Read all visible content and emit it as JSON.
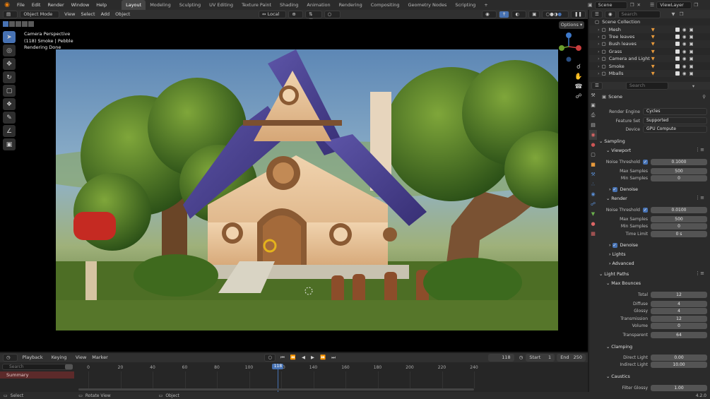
{
  "menu": {
    "items": [
      "File",
      "Edit",
      "Render",
      "Window",
      "Help"
    ]
  },
  "workspaces": [
    "Layout",
    "Modeling",
    "Sculpting",
    "UV Editing",
    "Texture Paint",
    "Shading",
    "Animation",
    "Rendering",
    "Compositing",
    "Geometry Nodes",
    "Scripting"
  ],
  "active_workspace": "Layout",
  "scene_field": "Scene",
  "viewlayer_field": "ViewLayer",
  "viewport_header": {
    "mode": "Object Mode",
    "menus": [
      "View",
      "Select",
      "Add",
      "Object"
    ],
    "transform_orientation": "Local",
    "options_label": "Options"
  },
  "viewport_info": {
    "line1": "Camera Perspective",
    "line2": "(118) Smoke | Pebble",
    "line3": "Rendering Done"
  },
  "timeline": {
    "header_menus": [
      "Playback",
      "Keying",
      "View",
      "Marker"
    ],
    "current_frame": "118",
    "start_label": "Start",
    "start": "1",
    "end_label": "End",
    "end": "250",
    "search_placeholder": "Search",
    "summary_label": "Summary",
    "ticks": [
      "0",
      "20",
      "40",
      "60",
      "80",
      "100",
      "120",
      "140",
      "160",
      "180",
      "200",
      "220",
      "240"
    ],
    "frame_min": 0,
    "frame_max": 250,
    "playhead_frame": 118
  },
  "statusbar": {
    "select": "Select",
    "rotate": "Rotate View",
    "object": "Object",
    "version": "4.2.0"
  },
  "outliner": {
    "search_placeholder": "Search",
    "root": "Scene Collection",
    "items": [
      "Mesh",
      "Tree leaves",
      "Bush leaves",
      "Grass",
      "Camera and Light",
      "Smoke",
      "Mballs"
    ]
  },
  "properties": {
    "search_placeholder": "Search",
    "context": "Scene",
    "render_engine_label": "Render Engine",
    "render_engine": "Cycles",
    "feature_set_label": "Feature Set",
    "feature_set": "Supported",
    "device_label": "Device",
    "device": "GPU Compute",
    "sampling": "Sampling",
    "viewport": "Viewport",
    "noise_threshold_label": "Noise Threshold",
    "vp_noise": "0.1000",
    "max_samples_label": "Max Samples",
    "vp_max": "500",
    "min_samples_label": "Min Samples",
    "vp_min": "0",
    "denoise": "Denoise",
    "render": "Render",
    "r_noise": "0.0100",
    "r_max": "500",
    "r_min": "0",
    "time_limit_label": "Time Limit",
    "r_time": "0 s",
    "lights": "Lights",
    "advanced": "Advanced",
    "light_paths": "Light Paths",
    "max_bounces": "Max Bounces",
    "total_label": "Total",
    "total": "12",
    "diffuse_label": "Diffuse",
    "diffuse": "4",
    "glossy_label": "Glossy",
    "glossy": "4",
    "transmission_label": "Transmission",
    "transmission": "12",
    "volume_label": "Volume",
    "volume": "0",
    "transparent_label": "Transparent",
    "transparent": "64",
    "clamping": "Clamping",
    "direct_light_label": "Direct Light",
    "direct_light": "0.00",
    "indirect_light_label": "Indirect Light",
    "indirect_light": "10.00",
    "caustics": "Caustics",
    "filter_glossy_label": "Filter Glossy",
    "filter_glossy": "1.00"
  },
  "colors": {
    "accent": "#4772b3",
    "panel": "#2b2b2b",
    "playhead": "#4772b3"
  }
}
